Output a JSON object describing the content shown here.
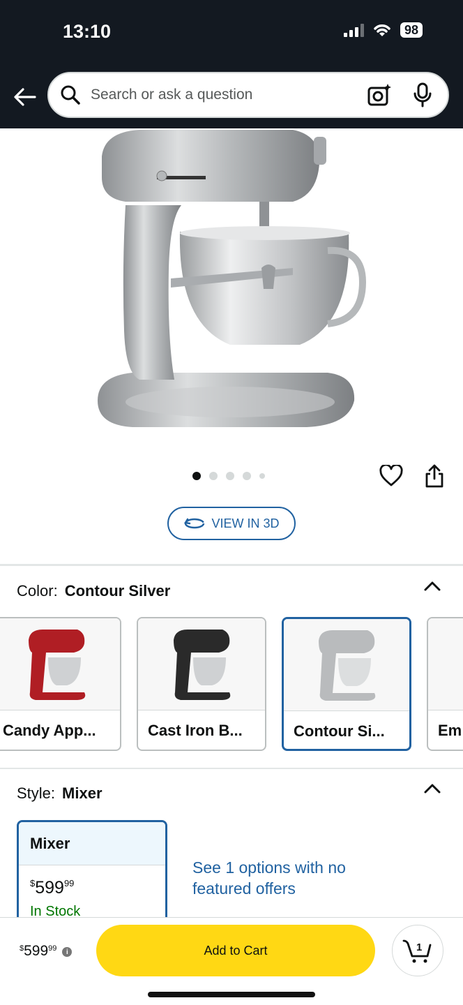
{
  "status": {
    "time": "13:10",
    "battery": "98"
  },
  "search": {
    "placeholder": "Search or ask a question"
  },
  "carousel": {
    "total_images": 5,
    "active_index": 0
  },
  "view3d": {
    "label": "VIEW IN 3D"
  },
  "color": {
    "label": "Color:",
    "selected": "Contour Silver",
    "options": [
      {
        "label": "Candy App...",
        "swatch_color": "#b01e24"
      },
      {
        "label": "Cast Iron B...",
        "swatch_color": "#2a2a2a"
      },
      {
        "label": "Contour Si...",
        "swatch_color": "#b9bbbd"
      },
      {
        "label": "Em",
        "swatch_color": "#b01e24"
      }
    ]
  },
  "style": {
    "label": "Style:",
    "selected": "Mixer",
    "card": {
      "title": "Mixer",
      "price_currency": "$",
      "price_whole": "599",
      "price_fraction": "99",
      "stock": "In Stock"
    },
    "options_link": "See 1 options with no featured offers"
  },
  "bottom": {
    "price_currency": "$",
    "price_whole": "599",
    "price_fraction": "99",
    "add_to_cart": "Add to Cart",
    "cart_count": "1"
  },
  "colors": {
    "accent": "#2162a1",
    "cta": "#ffd814",
    "header": "#131921",
    "in_stock": "#007600"
  }
}
